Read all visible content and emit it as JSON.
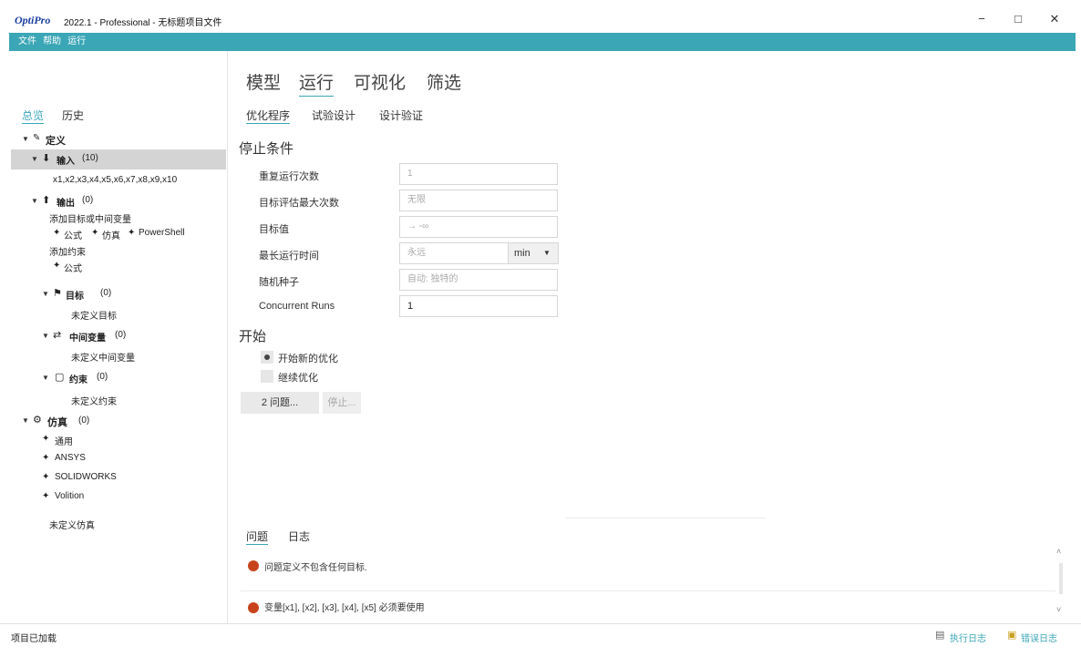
{
  "window": {
    "logo": "OptiPro",
    "title": "2022.1 - Professional - 无标题项目文件",
    "minimize": "−",
    "maximize": "□",
    "close": "✕"
  },
  "menu": [
    "文件",
    "帮助",
    "运行"
  ],
  "left": {
    "tabs": [
      "总览",
      "历史"
    ],
    "tree": {
      "definition": "定义",
      "inputs_label": "输入",
      "inputs_count": "(10)",
      "inputs_vars": "x1,x2,x3,x4,x5,x6,x7,x8,x9,x10",
      "outputs_label": "输出",
      "outputs_count": "(0)",
      "add_objective_hint": "添加目标或中间变量",
      "output_add_links": [
        "公式",
        "仿真",
        "PowerShell"
      ],
      "add_constraint_hint": "添加约束",
      "constraint_add_link": "公式",
      "objectives_label": "目标",
      "objectives_count": "(0)",
      "objectives_empty": "未定义目标",
      "intermediates_label": "中间变量",
      "intermediates_count": "(0)",
      "intermediates_empty": "未定义中间变量",
      "constraints_label": "约束",
      "constraints_count": "(0)",
      "constraints_empty": "未定义约束",
      "simulation_label": "仿真",
      "simulation_count": "(0)",
      "simulation_links": [
        "通用",
        "ANSYS",
        "SOLIDWORKS",
        "Volition"
      ],
      "simulation_empty": "未定义仿真"
    }
  },
  "main": {
    "tabs": [
      "模型",
      "运行",
      "可视化",
      "筛选"
    ],
    "subtabs": [
      "优化程序",
      "试验设计",
      "设计验证"
    ],
    "stop_conditions": {
      "title": "停止条件",
      "repeat_runs_label": "重复运行次数",
      "repeat_runs_placeholder": "1",
      "max_evals_label": "目标评估最大次数",
      "max_evals_placeholder": "无限",
      "target_label": "目标值",
      "target_placeholder": "→ -∞",
      "max_time_label": "最长运行时间",
      "max_time_placeholder": "永远",
      "time_unit": "min",
      "seed_label": "随机种子",
      "seed_placeholder": "自动: 独特的",
      "concurrent_label": "Concurrent Runs",
      "concurrent_value": "1"
    },
    "start": {
      "title": "开始",
      "new_opt": "开始新的优化",
      "continue_opt": "继续优化",
      "problems_button": "2 问题...",
      "stop_button": "停止..."
    },
    "bottom_tabs": [
      "问题",
      "日志"
    ],
    "issues": [
      "问题定义不包含任何目标.",
      "变量[x1], [x2], [x3], [x4], [x5] 必须要使用"
    ]
  },
  "status": {
    "text": "项目已加载",
    "exec_log": "执行日志",
    "error_log": "错误日志"
  },
  "colors": {
    "accent": "#3aa6b6",
    "error": "#c8431b"
  }
}
